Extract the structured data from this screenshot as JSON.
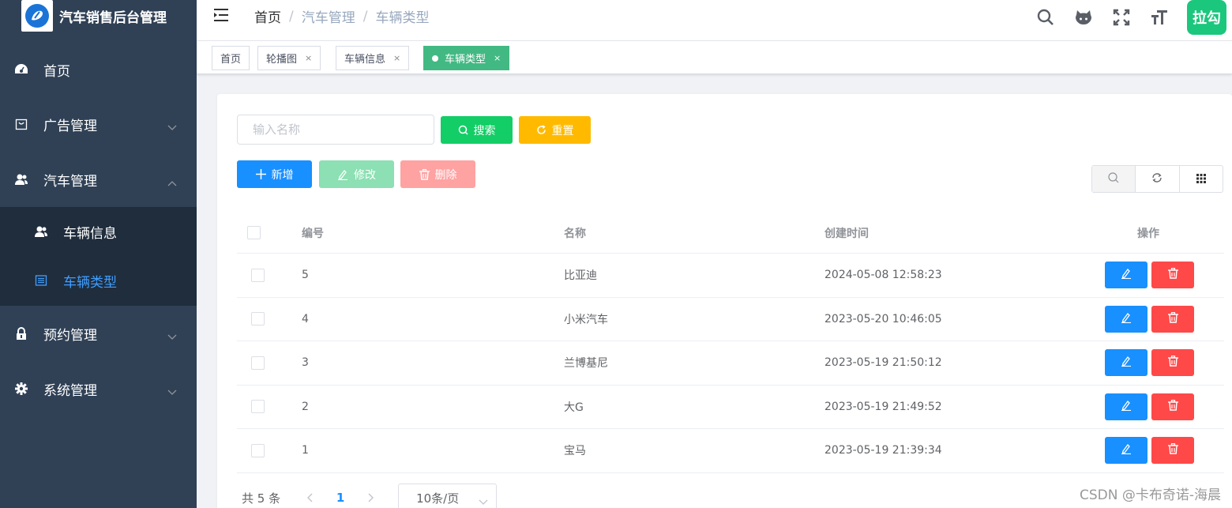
{
  "app": {
    "title": "汽车销售后台管理"
  },
  "sidebar": {
    "items": [
      {
        "label": "首页",
        "icon": "dashboard-icon"
      },
      {
        "label": "广告管理",
        "icon": "shopping-bag-icon"
      },
      {
        "label": "汽车管理",
        "icon": "users-icon"
      },
      {
        "label": "预约管理",
        "icon": "lock-icon"
      },
      {
        "label": "系统管理",
        "icon": "gear-icon"
      }
    ],
    "subitems": [
      {
        "label": "车辆信息",
        "icon": "users-icon"
      },
      {
        "label": "车辆类型",
        "icon": "list-icon"
      }
    ]
  },
  "breadcrumb": [
    "首页",
    "汽车管理",
    "车辆类型"
  ],
  "header": {
    "avatar_text": "拉勾"
  },
  "tags": [
    {
      "label": "首页"
    },
    {
      "label": "轮播图"
    },
    {
      "label": "车辆信息"
    },
    {
      "label": "车辆类型"
    }
  ],
  "tag_close": "×",
  "search": {
    "placeholder": "输入名称",
    "search_label": "搜索",
    "reset_label": "重置"
  },
  "toolbar": {
    "add_label": "新增",
    "edit_label": "修改",
    "delete_label": "删除"
  },
  "table": {
    "columns": [
      "编号",
      "名称",
      "创建时间",
      "操作"
    ],
    "rows": [
      {
        "id": "5",
        "name": "比亚迪",
        "created": "2024-05-08 12:58:23"
      },
      {
        "id": "4",
        "name": "小米汽车",
        "created": "2023-05-20 10:46:05"
      },
      {
        "id": "3",
        "name": "兰博基尼",
        "created": "2023-05-19 21:50:12"
      },
      {
        "id": "2",
        "name": "大G",
        "created": "2023-05-19 21:49:52"
      },
      {
        "id": "1",
        "name": "宝马",
        "created": "2023-05-19 21:39:34"
      }
    ]
  },
  "pagination": {
    "total": "共 5 条",
    "current": "1",
    "page_size": "10条/页"
  },
  "watermark": "CSDN @卡布奇诺-海晨",
  "colors": {
    "sidebar_bg": "#304156",
    "active_tag": "#42b983",
    "primary": "#1890ff",
    "success": "#13ce66",
    "warning": "#ffba00",
    "danger": "#ff4949"
  }
}
